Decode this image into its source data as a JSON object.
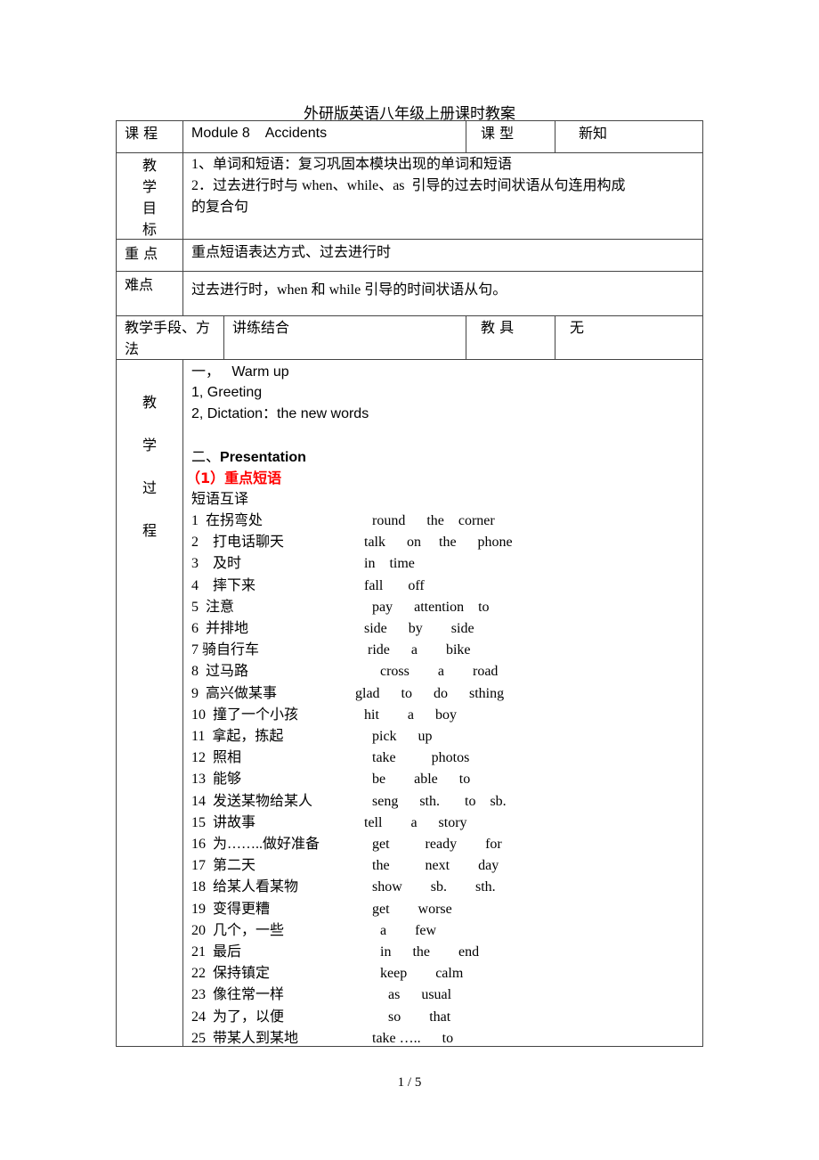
{
  "document": {
    "title": "外研版英语八年级上册课时教案",
    "page_number": "1 / 5"
  },
  "header_row": {
    "course_label": "课 程",
    "course_value": "Module 8    Accidents",
    "type_label": "课 型",
    "type_value": "新知"
  },
  "objectives": {
    "label_chars": [
      "教",
      "学",
      "目",
      "标"
    ],
    "line1": "1、单词和短语：复习巩固本模块出现的单词和短语",
    "line2": "2．过去进行时与 when、while、as  引导的过去时间状语从句连用构成",
    "line3": "的复合句"
  },
  "key_points": {
    "label": "重 点",
    "value": "重点短语表达方式、过去进行时"
  },
  "difficulties": {
    "label": "难点",
    "value": "过去进行时，when 和 while 引导的时间状语从句。"
  },
  "methods_row": {
    "label_line1": "教学手段、方",
    "label_line2": "法",
    "method_value": "讲练结合",
    "tools_label": "教 具",
    "tools_value": "无"
  },
  "process": {
    "label_chars": [
      "教",
      "学",
      "过",
      "程"
    ],
    "section1_heading_prefix": "一，",
    "section1_heading": "Warm up",
    "step1": "1, Greeting",
    "step2": "2, Dictation：the new words",
    "section2_prefix": "二、",
    "section2_heading": "Presentation",
    "subsection_heading": "（1）重点短语",
    "exercise_title": "短语互译",
    "phrases": [
      {
        "cn": "1  在拐弯处",
        "en": "round      the    corner"
      },
      {
        "cn": "2    打电话聊天",
        "en": "talk      on     the      phone"
      },
      {
        "cn": "3    及时",
        "en": "in    time"
      },
      {
        "cn": "4    摔下来",
        "en": "fall       off"
      },
      {
        "cn": "5  注意",
        "en": "pay      attention    to"
      },
      {
        "cn": "6  并排地",
        "en": "side      by        side"
      },
      {
        "cn": "7 骑自行车",
        "en": "ride      a        bike"
      },
      {
        "cn": "8  过马路",
        "en": "cross        a        road"
      },
      {
        "cn": "9  高兴做某事",
        "en": "glad      to      do      sthing"
      },
      {
        "cn": "10  撞了一个小孩",
        "en": "hit        a      boy"
      },
      {
        "cn": "11  拿起，拣起",
        "en": "pick      up"
      },
      {
        "cn": "12  照相",
        "en": "take          photos"
      },
      {
        "cn": "13  能够",
        "en": "be        able      to"
      },
      {
        "cn": "14  发送某物给某人",
        "en": "seng      sth.       to    sb."
      },
      {
        "cn": "15  讲故事",
        "en": "tell        a      story"
      },
      {
        "cn": "16  为……..做好准备",
        "en": "get          ready        for"
      },
      {
        "cn": "17  第二天",
        "en": "the          next        day"
      },
      {
        "cn": "18  给某人看某物",
        "en": "show        sb.        sth."
      },
      {
        "cn": "19  变得更糟",
        "en": "get        worse"
      },
      {
        "cn": "20  几个，一些",
        "en": "a        few"
      },
      {
        "cn": "21  最后",
        "en": "in      the        end"
      },
      {
        "cn": "22  保持镇定",
        "en": "keep        calm"
      },
      {
        "cn": "23  像往常一样",
        "en": "as      usual"
      },
      {
        "cn": "24  为了，以便",
        "en": "so        that"
      },
      {
        "cn": "25  带某人到某地",
        "en": "take …..      to"
      }
    ]
  }
}
